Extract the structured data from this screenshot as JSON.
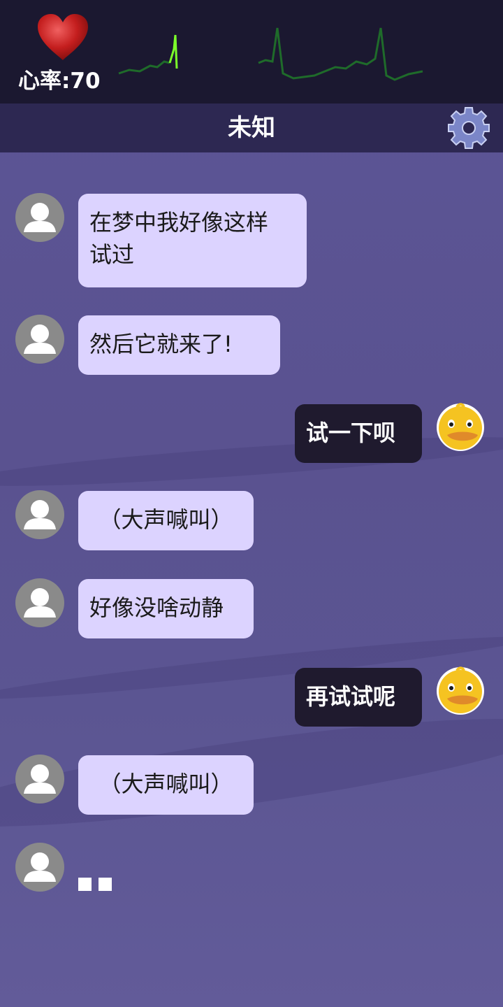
{
  "header": {
    "heart_rate_label": "心率:70"
  },
  "chat": {
    "title": "未知"
  },
  "messages": [
    {
      "side": "left",
      "text": "在梦中我好像这样\n试过"
    },
    {
      "side": "left",
      "text": "然后它就来了!"
    },
    {
      "side": "right",
      "text": "试一下呗"
    },
    {
      "side": "left",
      "text": "（大声喊叫）"
    },
    {
      "side": "left",
      "text": "好像没啥动静"
    },
    {
      "side": "right",
      "text": "再试试呢"
    },
    {
      "side": "left",
      "text": "（大声喊叫）"
    }
  ],
  "icons": {
    "heart": "heart-icon",
    "settings": "gear-icon",
    "contact_avatar": "user-icon",
    "self_avatar": "duck-icon"
  },
  "colors": {
    "top_bar": "#1b1830",
    "title_bar": "#2d2852",
    "left_bubble": "#dcd3ff",
    "right_bubble": "#1f1a2e",
    "ecg_line": "#1f6b2a",
    "ecg_active": "#7cff2a"
  }
}
